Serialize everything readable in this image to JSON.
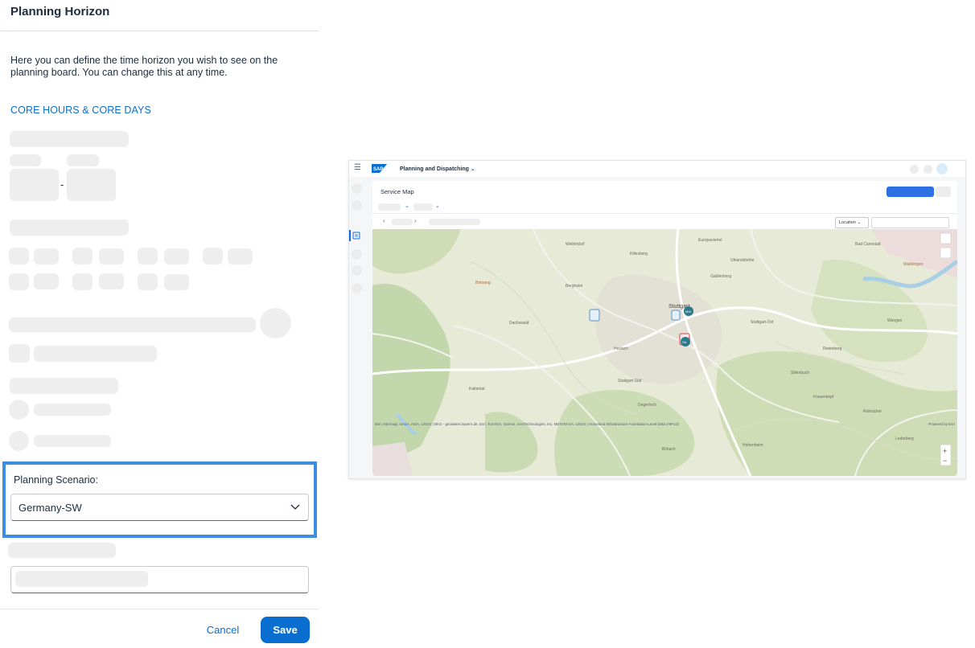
{
  "panel": {
    "title": "Planning Horizon",
    "description": "Here you can define the time horizon you wish to see on the planning board. You can change this at any time.",
    "core_link": "CORE HOURS & CORE DAYS",
    "range_separator": "-",
    "scenario": {
      "label": "Planning Scenario:",
      "value": "Germany-SW",
      "highlight_color": "#3d8ee1"
    },
    "actions": {
      "cancel": "Cancel",
      "save": "Save"
    },
    "accent_color": "#0a6ed1"
  },
  "preview": {
    "shell": {
      "menu_icon": "hamburger-icon",
      "logo": "SAP",
      "app_title": "Planning and Dispatching ⌄"
    },
    "card": {
      "title": "Service Map",
      "location_dropdown": "Location ⌄",
      "primary_button_color": "#2f6fe4"
    },
    "map": {
      "labels": [
        "Stuttgart",
        "Stuttgart-Ost",
        "Stuttgart-Süd",
        "Botnang",
        "Frauenkopf",
        "Rohracker",
        "Waiblingen",
        "Degerloch",
        "Kaltental",
        "Hohenheim",
        "Wangen",
        "Lederberg",
        "Europaviertel",
        "Killesberg",
        "Bergheim",
        "Dachswald",
        "Heslach",
        "Birkach",
        "Sillenbuch",
        "Gablenberg",
        "Uhlandshöhe",
        "Rotenberg",
        "Bad Cannstatt",
        "Weilimdorf"
      ],
      "markers": [
        "MW",
        "SA"
      ],
      "attribution": "Esri, Intermap, NASA, NGA, USGS | BKG - geodaten.bayern.de, Esri, TomTom, Garmin, GeoTechnologies, Inc, METI/NASA, USGS | Homeland Infrastructure Foundation-Level Data (HIFLD)",
      "powered_by": "Powered by Esri",
      "zoom_in": "+",
      "zoom_out": "−"
    }
  }
}
